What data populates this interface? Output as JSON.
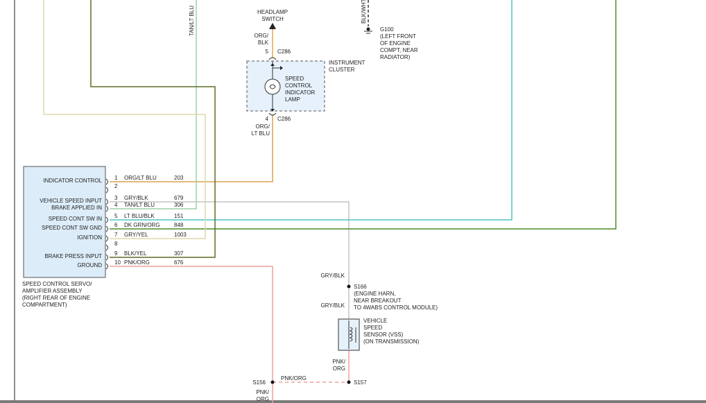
{
  "colors": {
    "org_blk": "#e8a54a",
    "org_ltblu": "#d8a24a",
    "tan_ltblu": "#9ccfa8",
    "gry_blk": "#c4c4c4",
    "lt_blu_blk": "#4fc4cc",
    "dk_grn_org": "#4f8a2a",
    "gry_yel": "#ddd9a8",
    "blk_yel": "#5a6f26",
    "pnk_org": "#f0a09a",
    "cluster_fill": "#e6f1fb",
    "module_fill": "#dcecf8",
    "module_stroke": "#555555",
    "ground_symbol": "#333333",
    "left_rule": "#444444",
    "bottom_bar": "#7a7a7a"
  },
  "top_labels": {
    "tan_lt_blu_vertical": "TAN/LT BLU",
    "blk_wht_vertical": "BLK/WHT",
    "headlamp_switch": [
      "HEADLAMP",
      "SWITCH"
    ],
    "org_blk_wire": [
      "ORG/",
      "BLK"
    ],
    "pin5": "5",
    "c286_top": "C286",
    "g100": [
      "G100",
      "(LEFT FRONT",
      "OF ENGINE",
      "COMPT, NEAR",
      "RADIATOR)"
    ]
  },
  "cluster": {
    "label": [
      "INSTRUMENT",
      "CLUSTER"
    ],
    "lamp_label": [
      "SPEED",
      "CONTROL",
      "INDICATOR",
      "LAMP"
    ],
    "pin4": "4",
    "c286_bottom": "C286",
    "wire_label": [
      "ORG/",
      "LT BLU"
    ]
  },
  "module": {
    "title": [
      "SPEED CONTROL SERVO/",
      "AMPLIFIER ASSEMBLY",
      "(RIGHT REAR OF ENGINE",
      "COMPARTMENT)"
    ],
    "pins": [
      {
        "name": "INDICATOR CONTROL",
        "num": "1",
        "wire": "ORG/LT BLU",
        "circuit": "203"
      },
      {
        "name": "",
        "num": "2",
        "wire": "",
        "circuit": ""
      },
      {
        "name": "VEHICLE SPEED INPUT",
        "num": "3",
        "wire": "GRY/BLK",
        "circuit": "679"
      },
      {
        "name": "BRAKE APPLIED IN",
        "num": "4",
        "wire": "TAN/LT BLU",
        "circuit": "306"
      },
      {
        "name": "SPEED CONT SW IN",
        "num": "5",
        "wire": "LT BLU/BLK",
        "circuit": "151"
      },
      {
        "name": "SPEED CONT SW GND",
        "num": "6",
        "wire": "DK GRN/ORG",
        "circuit": "848"
      },
      {
        "name": "IGNITION",
        "num": "7",
        "wire": "GRY/YEL",
        "circuit": "1003"
      },
      {
        "name": "",
        "num": "8",
        "wire": "",
        "circuit": ""
      },
      {
        "name": "BRAKE PRESS INPUT",
        "num": "9",
        "wire": "BLK/YEL",
        "circuit": "307"
      },
      {
        "name": "GROUND",
        "num": "10",
        "wire": "PNK/ORG",
        "circuit": "676"
      }
    ]
  },
  "vss": {
    "gry_blk_upper": "GRY/BLK",
    "s166": "S166",
    "s166_desc": [
      "(ENGINE HARN,",
      "NEAR BREAKOUT",
      "TO 4WABS CONTROL MODULE)"
    ],
    "gry_blk_lower": "GRY/BLK",
    "sensor_label": [
      "VEHICLE",
      "SPEED",
      "SENSOR (VSS)",
      "(ON TRANSMISSION)"
    ],
    "pnk_org_wire": [
      "PNK/",
      "ORG"
    ],
    "s157": "S157",
    "s156": "S156",
    "pnk_org_mid": "PNK/ORG",
    "pnk_org_bottom": [
      "PNK/",
      "ORG"
    ]
  }
}
